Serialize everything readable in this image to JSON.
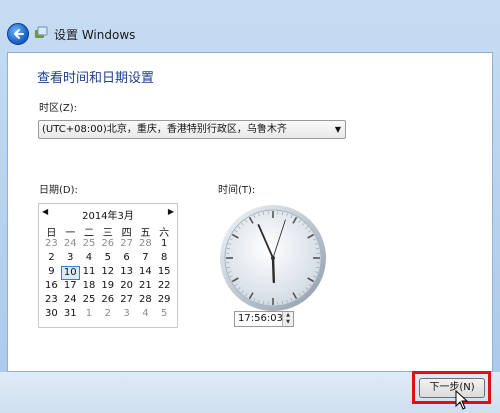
{
  "window": {
    "title": "设置 Windows"
  },
  "page": {
    "heading": "查看时间和日期设置"
  },
  "timezone": {
    "label": "时区(Z):",
    "selected": "(UTC+08:00)北京，重庆，香港特别行政区，乌鲁木齐"
  },
  "date": {
    "label": "日期(D):",
    "month_title": "2014年3月",
    "weekdays": [
      "日",
      "一",
      "二",
      "三",
      "四",
      "五",
      "六"
    ],
    "weeks": [
      [
        {
          "t": "23",
          "o": true
        },
        {
          "t": "24",
          "o": true
        },
        {
          "t": "25",
          "o": true
        },
        {
          "t": "26",
          "o": true
        },
        {
          "t": "27",
          "o": true
        },
        {
          "t": "28",
          "o": true
        },
        {
          "t": "1"
        }
      ],
      [
        {
          "t": "2"
        },
        {
          "t": "3"
        },
        {
          "t": "4"
        },
        {
          "t": "5"
        },
        {
          "t": "6"
        },
        {
          "t": "7"
        },
        {
          "t": "8"
        }
      ],
      [
        {
          "t": "9"
        },
        {
          "t": "10",
          "sel": true
        },
        {
          "t": "11"
        },
        {
          "t": "12"
        },
        {
          "t": "13"
        },
        {
          "t": "14"
        },
        {
          "t": "15"
        }
      ],
      [
        {
          "t": "16"
        },
        {
          "t": "17"
        },
        {
          "t": "18"
        },
        {
          "t": "19"
        },
        {
          "t": "20"
        },
        {
          "t": "21"
        },
        {
          "t": "22"
        }
      ],
      [
        {
          "t": "23"
        },
        {
          "t": "24"
        },
        {
          "t": "25"
        },
        {
          "t": "26"
        },
        {
          "t": "27"
        },
        {
          "t": "28"
        },
        {
          "t": "29"
        }
      ],
      [
        {
          "t": "30"
        },
        {
          "t": "31"
        },
        {
          "t": "1",
          "o": true
        },
        {
          "t": "2",
          "o": true
        },
        {
          "t": "3",
          "o": true
        },
        {
          "t": "4",
          "o": true
        },
        {
          "t": "5",
          "o": true
        }
      ]
    ]
  },
  "time": {
    "label": "时间(T):",
    "value": "17:56:03"
  },
  "footer": {
    "next_label": "下一步(N)"
  },
  "icons": {
    "back": "back-arrow-icon",
    "app": "windows-setup-icon",
    "clock": "analog-clock-icon",
    "cursor": "mouse-pointer-icon"
  },
  "colors": {
    "heading": "#1e3f8a",
    "highlight": "#e01010"
  }
}
